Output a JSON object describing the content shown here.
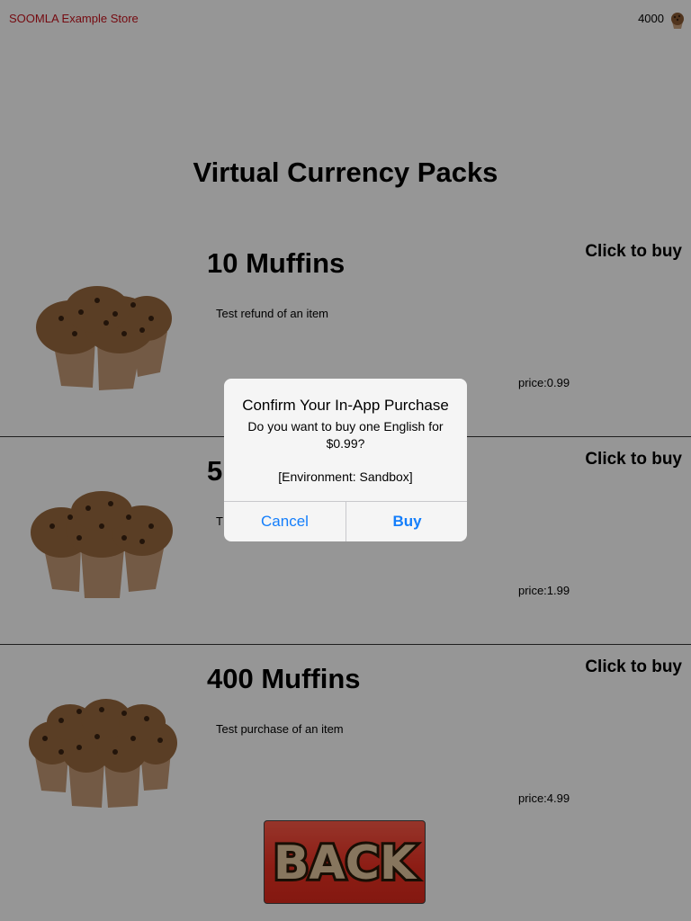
{
  "header": {
    "store_name": "SOOMLA Example Store",
    "balance": "4000",
    "balance_icon": "muffin-icon"
  },
  "page": {
    "title": "Virtual Currency Packs"
  },
  "packs": [
    {
      "name": "10 Muffins",
      "description": "Test refund of an item",
      "price": "price:0.99",
      "buy_label": "Click to buy",
      "image": "muffins-small-pack-image"
    },
    {
      "name": "5",
      "description": "T",
      "price": "price:1.99",
      "buy_label": "Click to buy",
      "image": "muffins-medium-pack-image"
    },
    {
      "name": "400 Muffins",
      "description": "Test purchase of an item",
      "price": "price:4.99",
      "buy_label": "Click to buy",
      "image": "muffins-large-pack-image"
    }
  ],
  "back_button": {
    "label": "BACK"
  },
  "dialog": {
    "title": "Confirm Your In-App Purchase",
    "message": "Do you want to buy one English for $0.99?",
    "environment": "[Environment: Sandbox]",
    "cancel_label": "Cancel",
    "buy_label": "Buy"
  },
  "colors": {
    "store_name": "#c8141e",
    "back_button": "#f03224",
    "dialog_button": "#147efb"
  }
}
